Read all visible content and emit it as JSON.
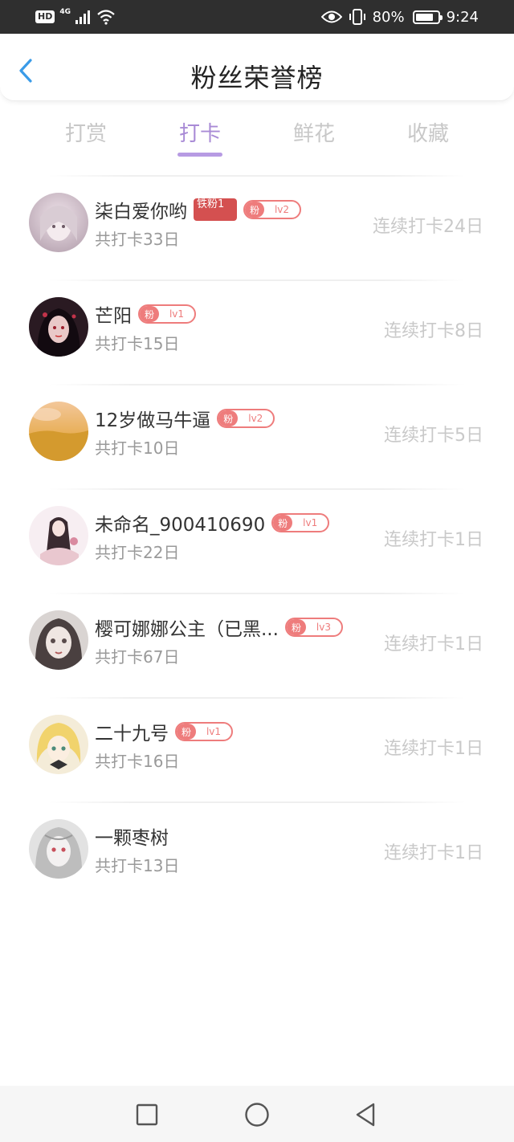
{
  "status_bar": {
    "hd": "HD",
    "network": "4G",
    "battery_text": "80%",
    "battery_level": 0.8,
    "time": "9:24",
    "icons": [
      "hd-icon",
      "signal-icon",
      "wifi-icon",
      "eye-icon",
      "vibrate-icon",
      "battery-icon"
    ]
  },
  "header": {
    "title": "粉丝荣誉榜",
    "back_icon": "chevron-left-icon",
    "accent": "#3a9be8"
  },
  "tabs": {
    "items": [
      "打赏",
      "打卡",
      "鲜花",
      "收藏"
    ],
    "active": "打卡",
    "active_color": "#a98bd6"
  },
  "list": {
    "rows": [
      {
        "name": "柒白爱你哟",
        "iron_badge": "铁粉1",
        "fan_tag": "粉",
        "level": "lv2",
        "total": "共打卡33日",
        "streak": "连续打卡24日"
      },
      {
        "name": "芒阳",
        "fan_tag": "粉",
        "level": "lv1",
        "total": "共打卡15日",
        "streak": "连续打卡8日"
      },
      {
        "name": "12岁做马牛逼",
        "fan_tag": "粉",
        "level": "lv2",
        "total": "共打卡10日",
        "streak": "连续打卡5日"
      },
      {
        "name": "未命名_900410690",
        "fan_tag": "粉",
        "level": "lv1",
        "total": "共打卡22日",
        "streak": "连续打卡1日"
      },
      {
        "name": "樱可娜娜公主（已黑...",
        "fan_tag": "粉",
        "level": "lv3",
        "total": "共打卡67日",
        "streak": "连续打卡1日"
      },
      {
        "name": "二十九号",
        "fan_tag": "粉",
        "level": "lv1",
        "total": "共打卡16日",
        "streak": "连续打卡1日"
      },
      {
        "name": "一颗枣树",
        "total": "共打卡13日",
        "streak": "连续打卡1日"
      }
    ]
  },
  "nav_bar": {
    "icons": [
      "square-icon",
      "circle-icon",
      "back-triangle-icon"
    ]
  }
}
